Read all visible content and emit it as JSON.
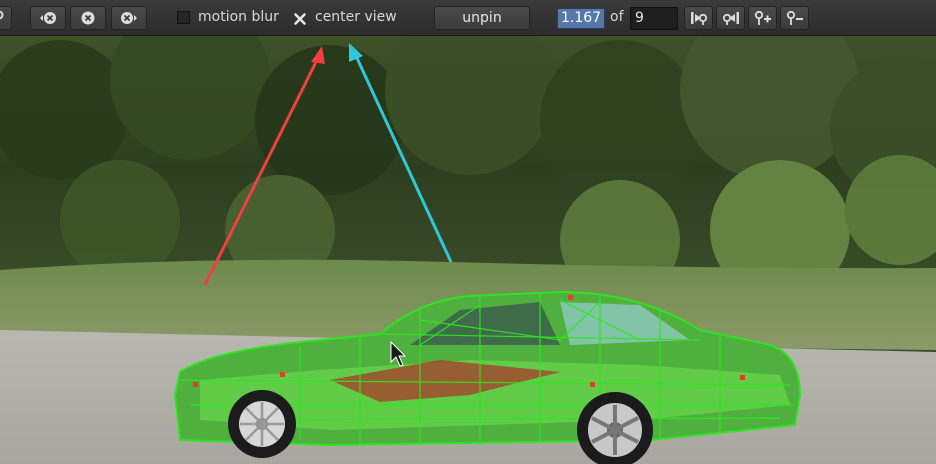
{
  "toolbar": {
    "motion_blur_label": "motion blur",
    "center_view_label": "center view",
    "unpin_label": "unpin",
    "current_frame": "1.167",
    "of_label": "of",
    "total_frames": "9"
  },
  "icons": [
    "pin-icon",
    "delete-left-icon",
    "delete-icon",
    "delete-right-icon",
    "checkbox-checked-icon",
    "keyframe-prev-icon",
    "keyframe-next-icon",
    "keyframe-add-icon",
    "keyframe-remove-icon",
    "mouse-cursor-icon"
  ],
  "colors": {
    "toolbar_bg": "#2f2f2f",
    "frame_highlight": "#5678a8",
    "mesh_green": "#2ee61e",
    "arrow_red": "#f04040",
    "arrow_cyan": "#30c8d8"
  }
}
